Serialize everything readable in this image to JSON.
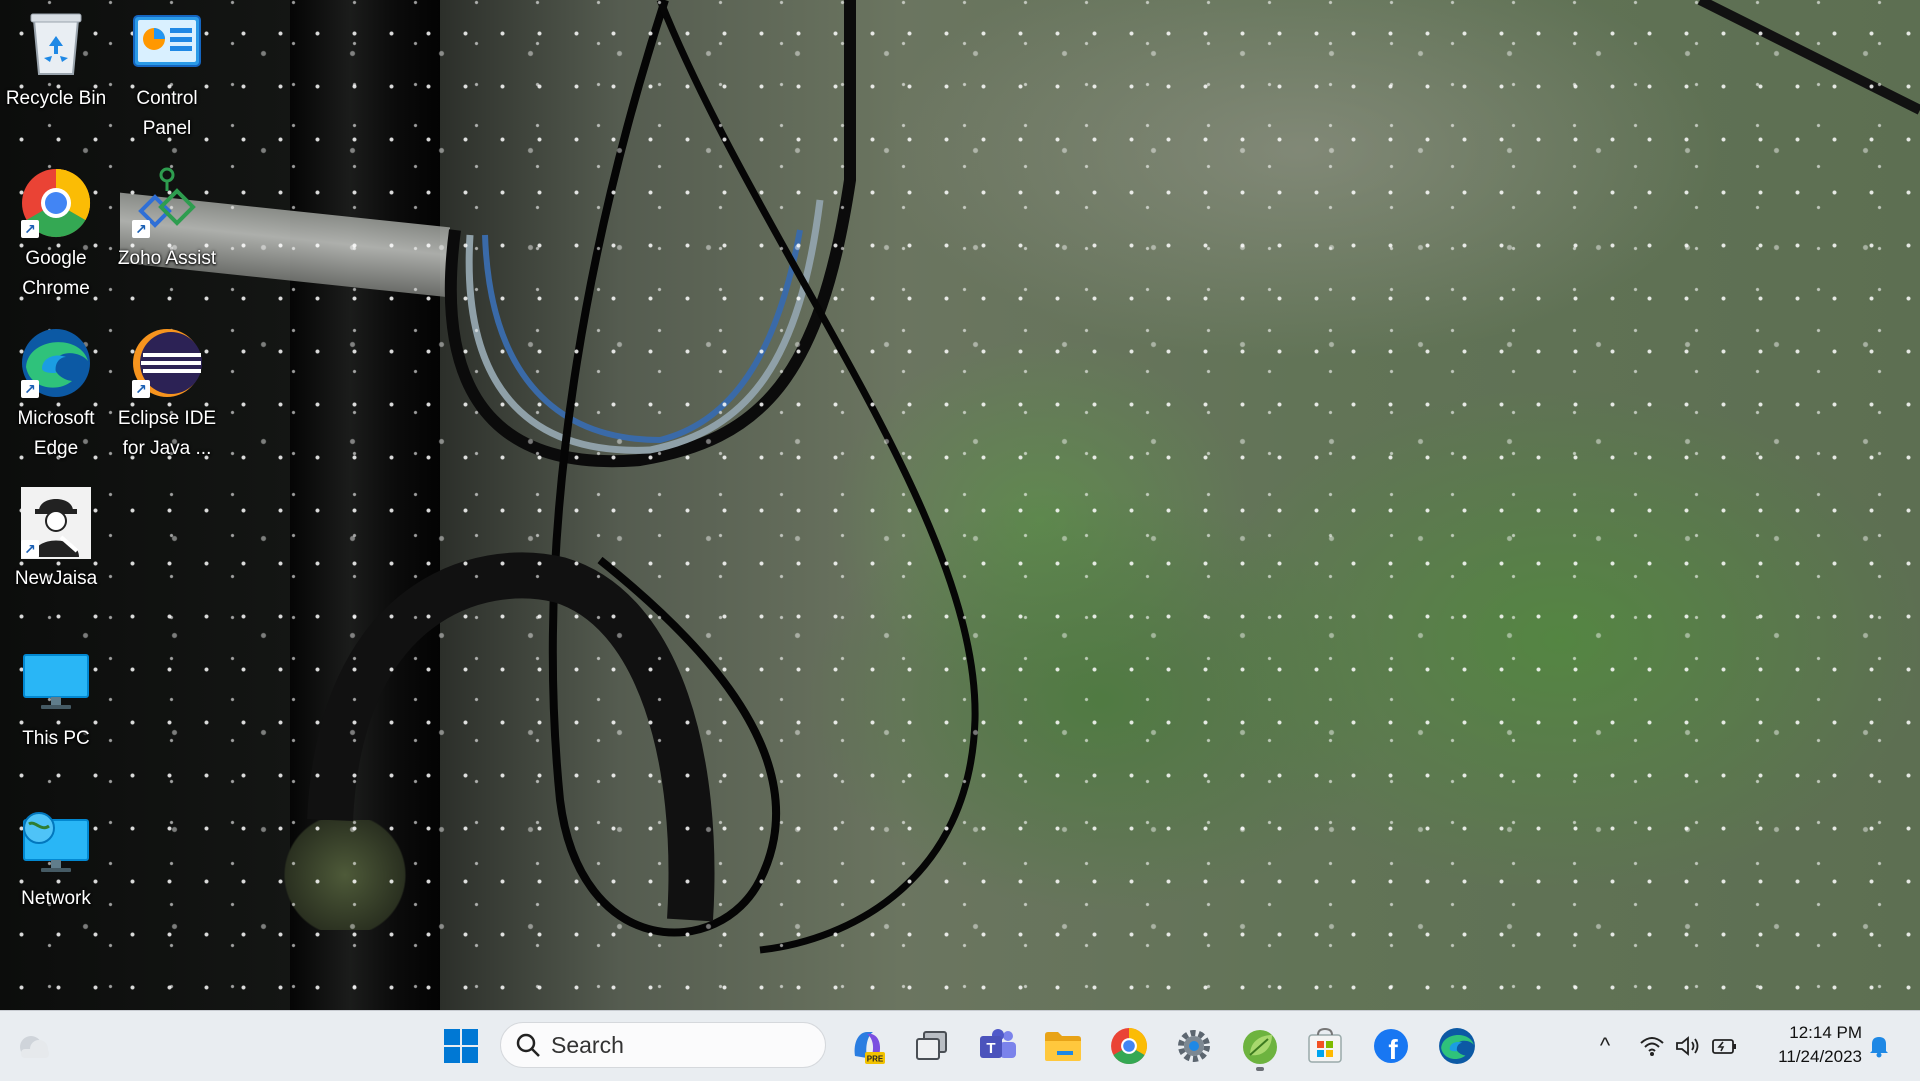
{
  "desktop": {
    "icons": [
      {
        "label": "Recycle Bin",
        "icon": "recycle-bin-icon",
        "shortcut": false
      },
      {
        "label": "Control Panel",
        "icon": "control-panel-icon",
        "shortcut": false
      },
      {
        "label": "Google Chrome",
        "icon": "chrome-icon",
        "shortcut": true
      },
      {
        "label": "Zoho Assist",
        "icon": "zoho-assist-icon",
        "shortcut": true
      },
      {
        "label": "Microsoft Edge",
        "icon": "edge-icon",
        "shortcut": true
      },
      {
        "label": "Eclipse IDE for Java ...",
        "icon": "eclipse-icon",
        "shortcut": true
      },
      {
        "label": "NewJaisa",
        "icon": "newjaisa-icon",
        "shortcut": true
      },
      {
        "label": "This PC",
        "icon": "this-pc-icon",
        "shortcut": false
      },
      {
        "label": "Network",
        "icon": "network-icon",
        "shortcut": false
      }
    ],
    "shortcut_glyph": "↗"
  },
  "taskbar": {
    "search": {
      "label": "Search"
    },
    "pinned": [
      {
        "name": "weather-widget",
        "icon": "weather-icon"
      },
      {
        "name": "start",
        "icon": "windows-start-icon"
      },
      {
        "name": "copilot",
        "icon": "copilot-icon",
        "badge": "PRE"
      },
      {
        "name": "task-view",
        "icon": "task-view-icon"
      },
      {
        "name": "teams",
        "icon": "teams-icon",
        "glyph": "T"
      },
      {
        "name": "file-explorer",
        "icon": "folder-icon"
      },
      {
        "name": "chrome",
        "icon": "chrome-icon"
      },
      {
        "name": "settings",
        "icon": "gear-icon"
      },
      {
        "name": "spring-tool",
        "icon": "spring-leaf-icon"
      },
      {
        "name": "microsoft-store",
        "icon": "store-icon"
      },
      {
        "name": "facebook",
        "icon": "facebook-icon",
        "glyph": "f"
      },
      {
        "name": "edge",
        "icon": "edge-icon"
      }
    ],
    "tray": {
      "chevron": "^",
      "icons": [
        "wifi-icon",
        "volume-icon",
        "battery-icon",
        "notification-bell-icon"
      ]
    },
    "clock": {
      "time": "12:14 PM",
      "date": "11/24/2023"
    }
  },
  "colors": {
    "taskbar_bg": "#e8ecf0",
    "accent_blue": "#0078d4",
    "chrome_red": "#ea4335",
    "chrome_yellow": "#fbbc05",
    "chrome_green": "#34a853",
    "chrome_blue": "#4285f4",
    "facebook_blue": "#1877f2"
  }
}
